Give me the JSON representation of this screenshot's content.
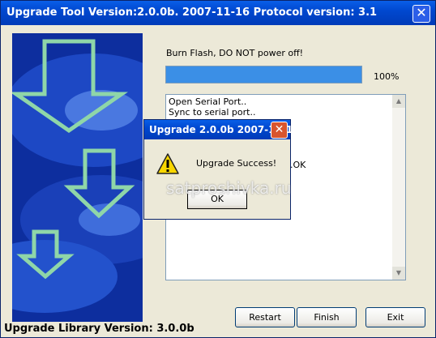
{
  "window": {
    "title": "Upgrade Tool Version:2.0.0b. 2007-11-16 Protocol version: 3.1",
    "close_glyph": "✕"
  },
  "status": {
    "message": "Burn Flash, DO NOT power off!",
    "progress_percent": 100,
    "progress_label": "100%"
  },
  "log": {
    "lines": [
      "Open Serial Port..",
      "Sync to serial port..",
      "y.OK"
    ]
  },
  "buttons": {
    "restart": "Restart",
    "finish": "Finish",
    "exit": "Exit"
  },
  "footer": {
    "library_version": "Upgrade Library Version: 3.0.0b"
  },
  "dialog": {
    "title": "Upgrade 2.0.0b 2007-11-16",
    "close_glyph": "✕",
    "message": "Upgrade Success!",
    "ok_label": "OK"
  },
  "watermark": "satproshivka.ru",
  "icons": {
    "close": "close-icon",
    "warning": "warning-icon",
    "banner": "down-arrows-banner"
  },
  "colors": {
    "titlebar": "#0048d0",
    "progress_fill": "#3b8fe6",
    "banner_bg": "#0d2e9e"
  }
}
